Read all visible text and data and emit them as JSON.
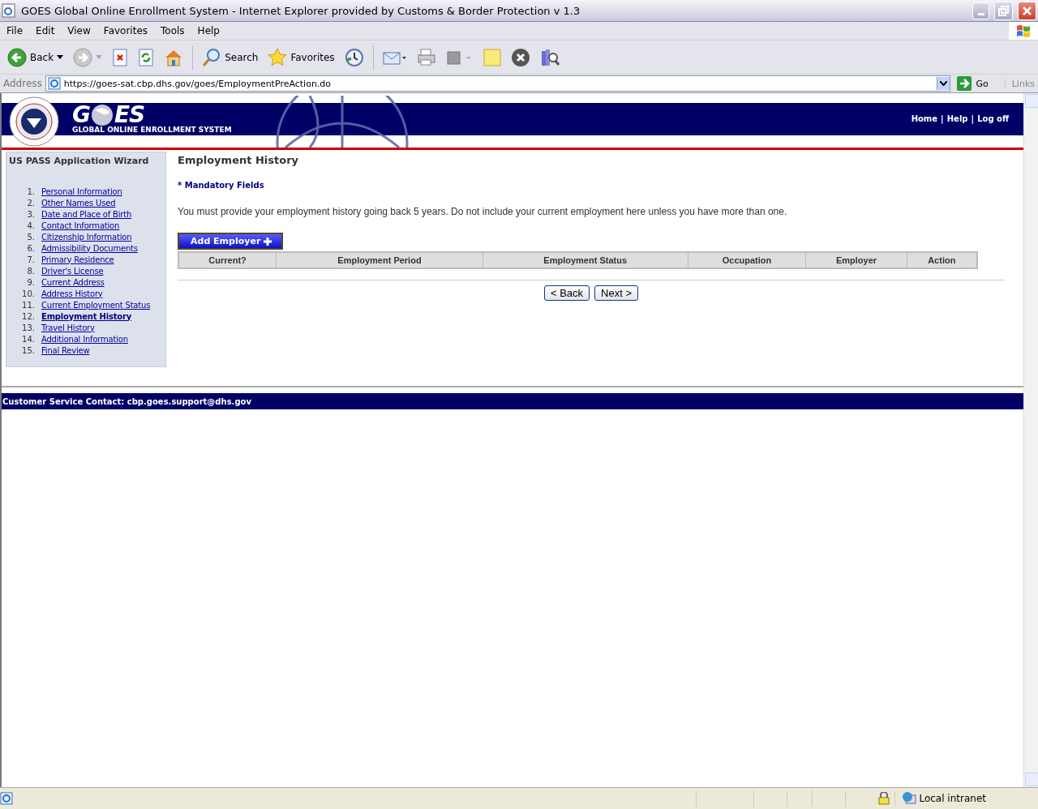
{
  "window": {
    "title": "GOES Global Online Enrollment System - Internet Explorer provided by Customs & Border Protection v 1.3"
  },
  "menu": [
    "File",
    "Edit",
    "View",
    "Favorites",
    "Tools",
    "Help"
  ],
  "toolbar": [
    {
      "kind": "back",
      "label": "Back"
    },
    {
      "kind": "forward"
    },
    {
      "kind": "stop"
    },
    {
      "kind": "refresh"
    },
    {
      "kind": "home"
    },
    {
      "kind": "search",
      "label": "Search"
    },
    {
      "kind": "favorites",
      "label": "Favorites"
    },
    {
      "kind": "history"
    },
    {
      "kind": "mail"
    },
    {
      "kind": "print"
    },
    {
      "kind": "edit"
    },
    {
      "kind": "note"
    },
    {
      "kind": "close"
    },
    {
      "kind": "research"
    }
  ],
  "address_bar": {
    "label": "Address",
    "url": "https://goes-sat.cbp.dhs.gov/goes/EmploymentPreAction.do",
    "go": "Go",
    "links": "Links"
  },
  "banner": {
    "logo_left": "G",
    "logo_right": "ES",
    "subtitle": "GLOBAL ONLINE ENROLLMENT SYSTEM",
    "nav": [
      "Home",
      "Help",
      "Log off"
    ],
    "nav_separator": "|"
  },
  "sidebar": {
    "title": "US PASS Application Wizard",
    "items": [
      {
        "number": "1.",
        "label": "Personal Information",
        "selected": false
      },
      {
        "number": "2.",
        "label": "Other Names Used",
        "selected": false
      },
      {
        "number": "3.",
        "label": "Date and Place of Birth",
        "selected": false
      },
      {
        "number": "4.",
        "label": "Contact Information",
        "selected": false
      },
      {
        "number": "5.",
        "label": "Citizenship Information",
        "selected": false
      },
      {
        "number": "6.",
        "label": "Admissibility Documents",
        "selected": false
      },
      {
        "number": "7.",
        "label": "Primary Residence",
        "selected": false
      },
      {
        "number": "8.",
        "label": "Driver's License",
        "selected": false
      },
      {
        "number": "9.",
        "label": "Current Address",
        "selected": false
      },
      {
        "number": "10.",
        "label": "Address History",
        "selected": false
      },
      {
        "number": "11.",
        "label": "Current Employment Status",
        "selected": false
      },
      {
        "number": "12.",
        "label": "Employment History",
        "selected": true
      },
      {
        "number": "13.",
        "label": "Travel History",
        "selected": false
      },
      {
        "number": "14.",
        "label": "Additional Information",
        "selected": false
      },
      {
        "number": "15.",
        "label": "Final Review",
        "selected": false
      }
    ]
  },
  "content": {
    "heading": "Employment History",
    "mandatory": "* Mandatory Fields",
    "instructions": "You must provide your employment history going back 5 years. Do not include your current employment here unless you have more than one.",
    "add_button": "Add Employer",
    "table": {
      "columns": [
        "Current?",
        "Employment Period",
        "Employment Status",
        "Occupation",
        "Employer",
        "Action"
      ]
    },
    "buttons": [
      "< Back",
      "Next >"
    ]
  },
  "footer": {
    "contact": "Customer Service Contact: cbp.goes.support@dhs.gov"
  },
  "status_bar": {
    "zone": "Local intranet"
  }
}
